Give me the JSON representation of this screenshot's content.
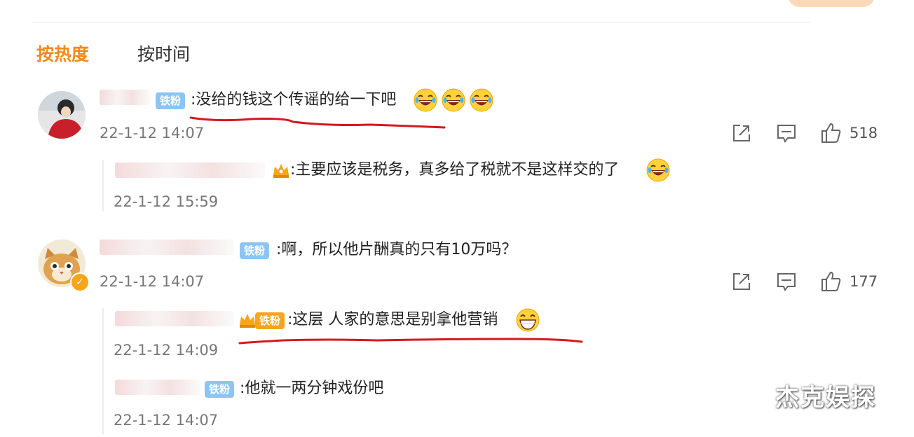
{
  "sort_tabs": {
    "hot": "按热度",
    "time": "按时间"
  },
  "comments": [
    {
      "badge": "铁粉",
      "text": ":没给的钱这个传谣的给一下吧",
      "time": "22-1-12 14:07",
      "likes": "518",
      "replies": [
        {
          "text": ":主要应该是税务，真多给了税就不是这样交的了",
          "time": "22-1-12 15:59"
        }
      ]
    },
    {
      "badge": "铁粉",
      "text": ":啊，所以他片酬真的只有10万吗？",
      "time": "22-1-12 14:07",
      "likes": "177",
      "replies": [
        {
          "badge": "铁粉",
          "text": ":这层 人家的意思是别拿他营销",
          "time": "22-1-12 14:09"
        },
        {
          "badge": "铁粉",
          "text": ":他就一两分钟戏份吧",
          "time": "22-1-12 14:07"
        }
      ]
    }
  ],
  "watermark": "杰克娱探",
  "colors": {
    "accent": "#f08a1c",
    "badge_blue": "#8ec4f0",
    "underline": "#d6181e"
  },
  "icons": [
    "share-icon",
    "comment-icon",
    "like-icon",
    "laughing-emoji",
    "grin-emoji",
    "verified-icon",
    "fan-crown-icon"
  ]
}
